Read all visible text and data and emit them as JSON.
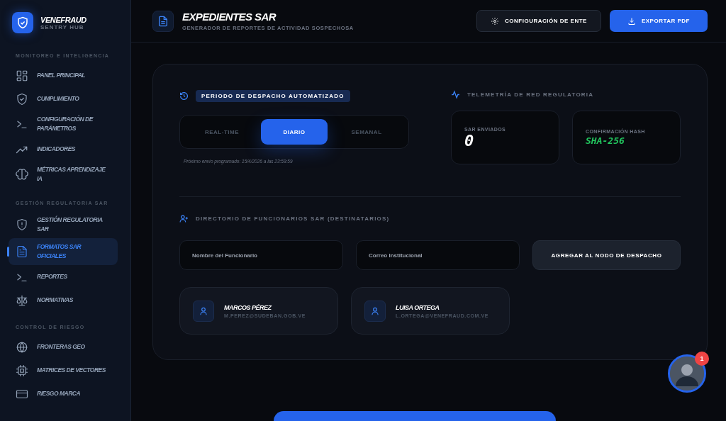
{
  "brand": {
    "name": "VENEFRAUD",
    "subtitle": "SENTRY HUB"
  },
  "sidebar": {
    "sections": [
      {
        "title": "MONITOREO E INTELIGENCIA",
        "items": [
          {
            "label": "PANEL PRINCIPAL",
            "selected": false
          },
          {
            "label": "CUMPLIMIENTO",
            "selected": false
          },
          {
            "label": "CONFIGURACIÓN DE PARÁMETROS",
            "selected": false
          },
          {
            "label": "INDICADORES",
            "selected": false
          },
          {
            "label": "MÉTRICAS APRENDIZAJE IA",
            "selected": false
          }
        ]
      },
      {
        "title": "GESTIÓN REGULATORIA SAR",
        "items": [
          {
            "label": "GESTIÓN REGULATORIA SAR",
            "selected": false
          },
          {
            "label": "FORMATOS SAR OFICIALES",
            "selected": true
          },
          {
            "label": "REPORTES",
            "selected": false
          },
          {
            "label": "NORMATIVAS",
            "selected": false
          }
        ]
      },
      {
        "title": "CONTROL DE RIESGO",
        "items": [
          {
            "label": "FRONTERAS GEO",
            "selected": false
          },
          {
            "label": "MATRICES DE VECTORES",
            "selected": false
          },
          {
            "label": "RIESGO MARCA",
            "selected": false
          }
        ]
      }
    ]
  },
  "header": {
    "title": "EXPEDIENTES SAR",
    "subtitle": "GENERADOR DE REPORTES DE ACTIVIDAD SOSPECHOSA",
    "buttons": [
      {
        "label": "CONFIGURACIÓN DE ENTE",
        "kind": "secondary"
      },
      {
        "label": "EXPORTAR PDF",
        "kind": "primary"
      }
    ]
  },
  "dispatch": {
    "title": "PERIODO DE DESPACHO AUTOMATIZADO",
    "options": [
      {
        "label": "REAL-TIME",
        "selected": false
      },
      {
        "label": "DIARIO",
        "selected": true
      },
      {
        "label": "SEMANAL",
        "selected": false
      }
    ],
    "next_run": "Próximo envío programado: 15/4/2026 a las 23:59:59"
  },
  "telemetry": {
    "title": "TELEMETRÍA DE RED REGULATORIA",
    "stats": [
      {
        "label": "SAR ENVIADOS",
        "value": "0",
        "kind": "count"
      },
      {
        "label": "CONFIRMACIÓN HASH",
        "value": "SHA-256",
        "kind": "hash"
      }
    ]
  },
  "directory": {
    "title": "DIRECTORIO DE FUNCIONARIOS SAR (DESTINATARIOS)",
    "name_field": {
      "placeholder": "Nombre del Funcionario"
    },
    "email_field": {
      "placeholder": "Correo Institucional"
    },
    "add_button": "AGREGAR AL NODO DE DESPACHO",
    "officials": [
      {
        "name": "MARCOS PÉREZ",
        "email": "M.PEREZ@SUDEBAN.GOB.VE"
      },
      {
        "name": "LUISA ORTEGA",
        "email": "L.ORTEGA@VENEFRAUD.COM.VE"
      }
    ]
  },
  "assistant": {
    "badge": "1"
  }
}
